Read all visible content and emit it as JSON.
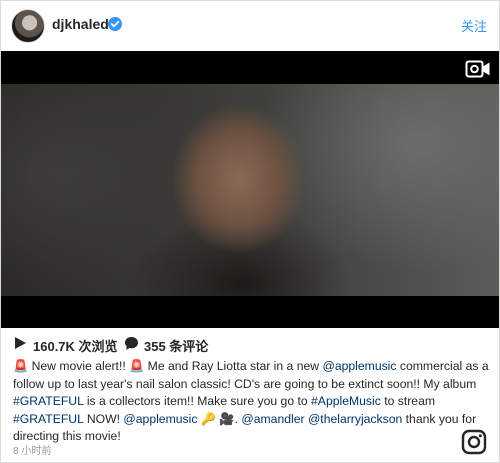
{
  "header": {
    "username": "djkhaled",
    "follow_label": "关注"
  },
  "stats": {
    "views": "160.7K 次浏览",
    "comments": "355 条评论"
  },
  "caption": {
    "seg1": " New movie alert!! ",
    "seg2": " Me and Ray Liotta star in a new ",
    "mention1": "@applemusic",
    "seg3": " commercial as a follow up to last year's nail salon classic! CD's are going to be extinct soon!! My album ",
    "hashtag1": "#GRATEFUL",
    "seg4": " is a collectors item!! Make sure you go to ",
    "hashtag2": "#AppleMusic",
    "seg5": " to stream ",
    "hashtag3": "#GRATEFUL",
    "seg6": " NOW! ",
    "mention2": "@applemusic",
    "seg7": ". ",
    "mention3": "@amandler",
    "mention4": "@thelarryjackson",
    "seg8": " thank you for directing this movie!",
    "emoji_siren": "🚨",
    "emoji_key": "🔑",
    "emoji_camera": "🎥"
  },
  "timestamp": "8 小时前",
  "colors": {
    "link": "#003569",
    "follow": "#3897f0",
    "verified": "#3897f0"
  }
}
